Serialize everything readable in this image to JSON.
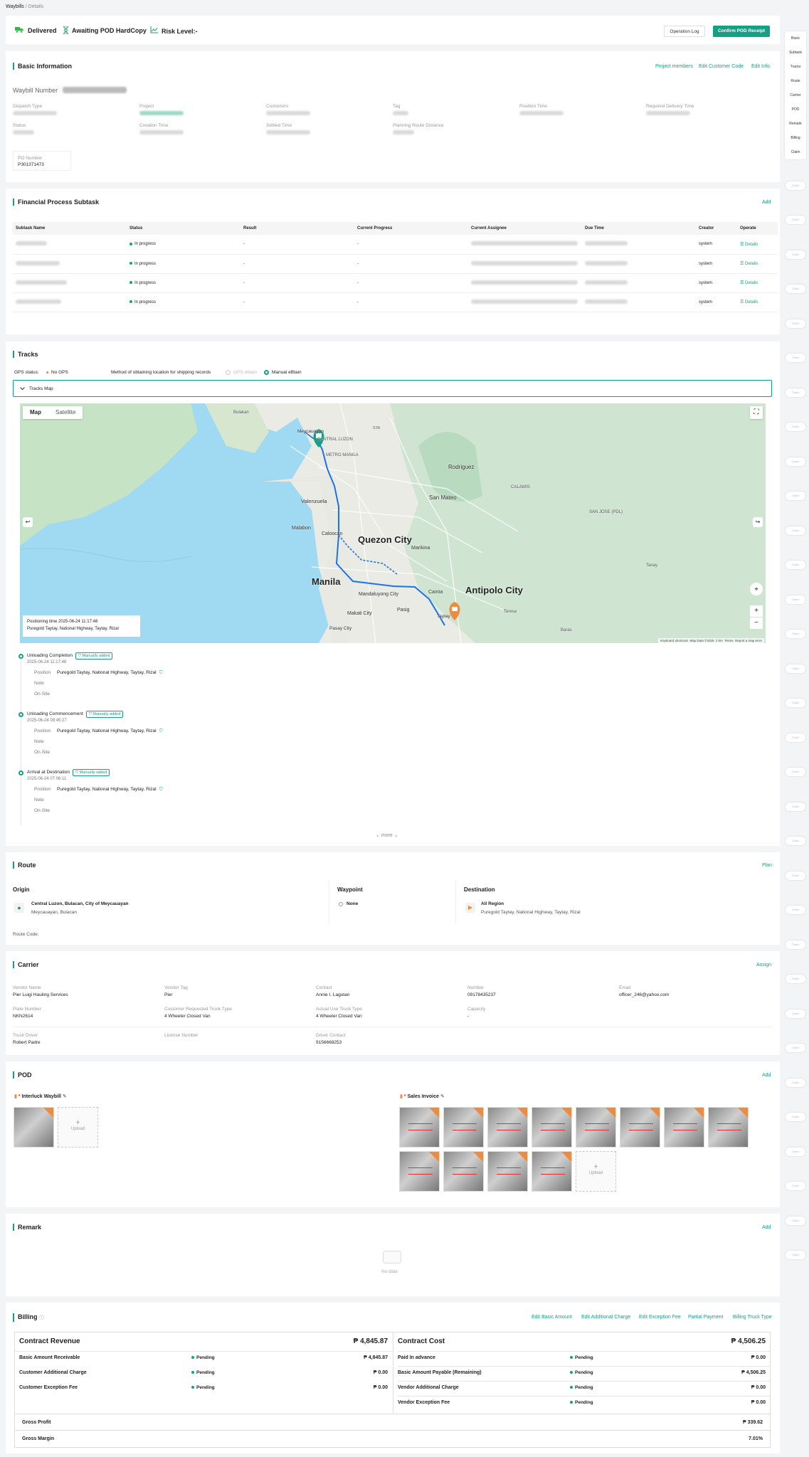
{
  "breadcrumb": {
    "root": "Waybills",
    "sep": "/",
    "current": "Details"
  },
  "header": {
    "status_delivered": "Delivered",
    "status_pod": "Awaiting POD HardCopy",
    "risk": "Risk Level:-",
    "btn_log": "Operation Log",
    "btn_confirm": "Confirm POD Receipt"
  },
  "rail": [
    "Basic",
    "Subtask",
    "Tracks",
    "Route",
    "Carrier",
    "POD",
    "Remark",
    "Billing",
    "Claim"
  ],
  "rail_pill": "Claim",
  "basic": {
    "title": "Basic Information",
    "links": [
      "Project members",
      "Edit Customer Code",
      "Edit Info."
    ],
    "waybill_label": "Waybill Number",
    "row1_labels": [
      "Dispatch Type",
      "Project",
      "Customers",
      "Tag",
      "Position Time",
      "Required Delivery Time"
    ],
    "row2_labels": [
      "Status",
      "Creation Time",
      "Settled Time",
      "Planning Route Distance"
    ],
    "po_label": "PO Number",
    "po_value": "P301371473"
  },
  "subtask": {
    "title": "Financial Process Subtask",
    "add": "Add",
    "columns": [
      "Subtask Name",
      "Status",
      "Result",
      "Current Progress",
      "Current Assignee",
      "Due Time",
      "Creator",
      "Operate"
    ],
    "rows": [
      {
        "status": "In progress",
        "result": "-",
        "progress": "-",
        "creator": "system",
        "op": "Details"
      },
      {
        "status": "In progress",
        "result": "-",
        "progress": "-",
        "creator": "system",
        "op": "Details"
      },
      {
        "status": "In progress",
        "result": "-",
        "progress": "-",
        "creator": "system",
        "op": "Details"
      },
      {
        "status": "In progress",
        "result": "-",
        "progress": "-",
        "creator": "system",
        "op": "Details"
      }
    ]
  },
  "tracks": {
    "title": "Tracks",
    "gps_label": "GPS status:",
    "gps_value": "No GPS",
    "method_label": "Method of obtaining location for shipping records",
    "opt_gps": "GPS obtain",
    "opt_manual": "Manual eBtain",
    "map_toggle": "Tracks Map",
    "map": {
      "tab_map": "Map",
      "tab_satellite": "Satellite",
      "positioning": "Positioning time 2025-06-24 11:17:48",
      "place": "Puregold Taytay, National Highway, Taytay, Rizal",
      "footer": [
        "Keyboard shortcuts",
        "Map Data ©2025",
        "2 km",
        "Terms",
        "Report a map error"
      ],
      "labels": {
        "manila": "Manila",
        "qc": "Quezon City",
        "antipolo": "Antipolo City",
        "rodriguez": "Rodriguez",
        "sanmateo": "San Mateo",
        "valenzuela": "Valenzuela",
        "malabon": "Malabon",
        "caloocan": "Caloocan",
        "marikina": "Marikina",
        "mandaluyong": "Mandaluyong City",
        "makati": "Makati City",
        "pasig": "Pasig",
        "pasay": "Pasay City",
        "cainta": "Cainta",
        "taytay": "Taytay",
        "meycauayan": "Meycauayan",
        "bulakan": "Bulakan",
        "calawis": "CALAWIS",
        "sanjose": "SAN JOSE (PDL)",
        "teresa": "Teresa",
        "tanay": "Tanay",
        "baras": "Baras",
        "sta": "STA",
        "centralluzon": "CENTRAL LUZON",
        "metromanila": "METRO MANILA"
      }
    },
    "events": [
      {
        "name": "Unloading Completion",
        "tag": "Manually added",
        "time": "2025-06-24 11:17:48",
        "pos_label": "Position",
        "pos": "Puregold Taytay, National Highway, Taytay, Rizal",
        "note": "Note",
        "onsite": "On-Site"
      },
      {
        "name": "Unloading Commencement",
        "tag": "Manually added",
        "time": "2025-06-24 08:45:27",
        "pos_label": "Position",
        "pos": "Puregold Taytay, National Highway, Taytay, Rizal",
        "note": "Note",
        "onsite": "On-Site"
      },
      {
        "name": "Arrival at Destination",
        "tag": "Manually added",
        "time": "2025-06-24 07:06:11",
        "pos_label": "Position",
        "pos": "Puregold Taytay, National Highway, Taytay, Rizal",
        "note": "Note",
        "onsite": "On-Site"
      }
    ],
    "more": "more"
  },
  "route": {
    "title": "Route",
    "plan": "Plan",
    "origin_h": "Origin",
    "origin_1": "Central Luzon, Bulacan, City of Meycauayan",
    "origin_2": "Meycauayan, Bulacan",
    "waypoint_h": "Waypoint",
    "waypoint": "None",
    "dest_h": "Destination",
    "dest_1": "All Region",
    "dest_2": "Puregold Taytay, National Highway, Taytay, Rizal",
    "code": "Route Code:"
  },
  "carrier": {
    "title": "Carrier",
    "assign": "Assign",
    "fields": [
      {
        "l": "Vendor Name",
        "v": "Pier Luigi Hauling Services"
      },
      {
        "l": "Vendor Tag",
        "v": "Pier"
      },
      {
        "l": "Contact",
        "v": "Annie I. Lagutan"
      },
      {
        "l": "Number",
        "v": "09178435237"
      },
      {
        "l": "Email",
        "v": "officer_246@yahoo.com"
      },
      {
        "l": "Plate Number",
        "v": "NKN2614"
      },
      {
        "l": "Customer Requested Truck Type",
        "v": "4 Wheeler Closed Van"
      },
      {
        "l": "Actual Use Truck Type",
        "v": "4 Wheeler Closed Van"
      },
      {
        "l": "Capacity",
        "v": "-"
      },
      {
        "l": "Truck Driver",
        "v": "Robert Padre"
      },
      {
        "l": "License Number",
        "v": ""
      },
      {
        "l": "Driver Contact",
        "v": "9156668253"
      }
    ]
  },
  "pod": {
    "title": "POD",
    "add": "Add",
    "interluck": "Interluck Waybill",
    "sales": "Sales Invoice",
    "upload": "Upload",
    "star": "*"
  },
  "remark": {
    "title": "Remark",
    "add": "Add",
    "nodata": "No data"
  },
  "billing": {
    "title": "Billing",
    "links": [
      "Edit Basic Amount",
      "Edit Additional Charge",
      "Edit Exception Fee",
      "Partial Payment",
      "Billing Truck Type"
    ],
    "rev_h": "Contract Revenue",
    "rev_total": "₱ 4,845.87",
    "cost_h": "Contract Cost",
    "cost_total": "₱ 4,506.25",
    "rev": [
      {
        "n": "Basic Amount Receivable",
        "s": "Pending",
        "v": "₱ 4,845.87"
      },
      {
        "n": "Customer Additional Charge",
        "s": "Pending",
        "v": "₱ 0.00"
      },
      {
        "n": "Customer Exception Fee",
        "s": "Pending",
        "v": "₱ 0.00"
      }
    ],
    "cost": [
      {
        "n": "Paid In advance",
        "s": "Pending",
        "v": "₱ 0.00"
      },
      {
        "n": "Basic Amount Payable (Remaining)",
        "s": "Pending",
        "v": "₱ 4,506.25"
      },
      {
        "n": "Vendor Additional Charge",
        "s": "Pending",
        "v": "₱ 0.00"
      },
      {
        "n": "Vendor Exception Fee",
        "s": "Pending",
        "v": "₱ 0.00"
      }
    ],
    "gp_l": "Gross Profit",
    "gp_v": "₱ 339.62",
    "gm_l": "Gross Margin",
    "gm_v": "7.01%"
  },
  "colors": {
    "accent": "#14a085",
    "orange": "#f08a3c",
    "route": "#1a73e8"
  }
}
